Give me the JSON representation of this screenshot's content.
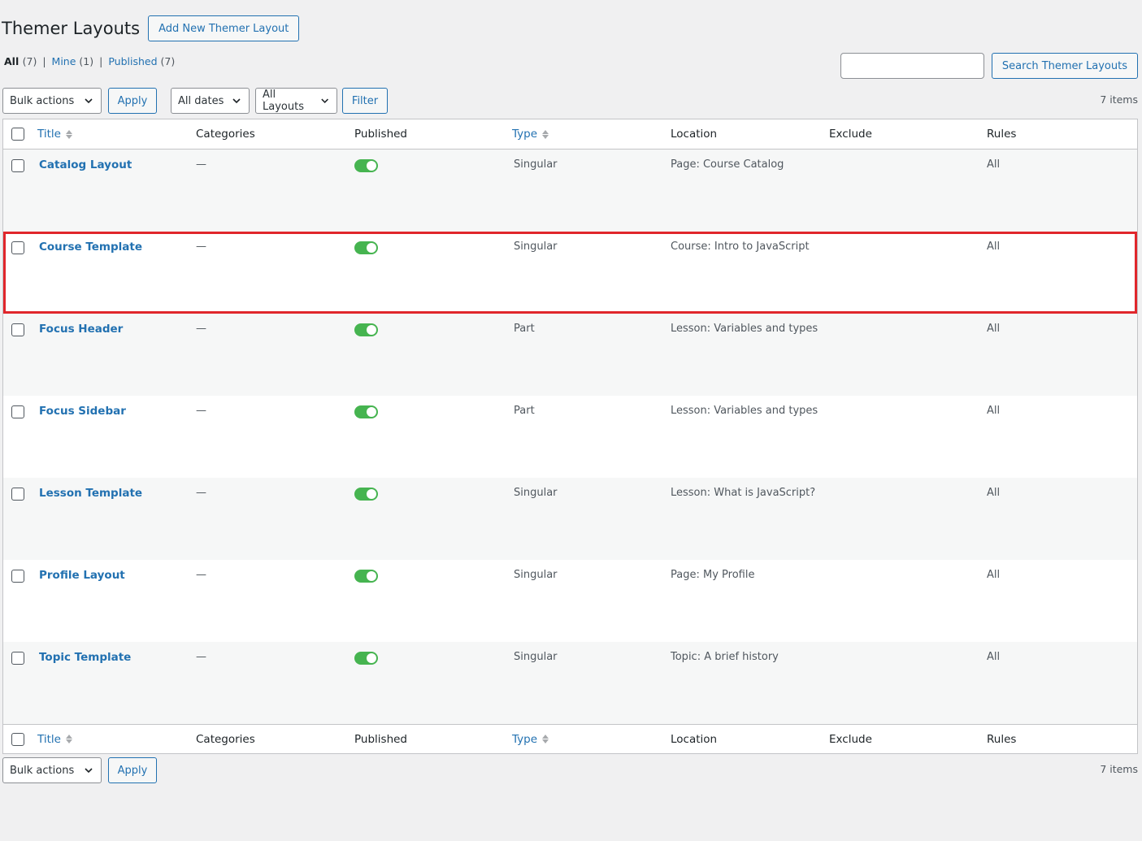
{
  "header": {
    "title": "Themer Layouts",
    "add_new_label": "Add New Themer Layout"
  },
  "views": [
    {
      "label": "All",
      "count": "(7)"
    },
    {
      "label": "Mine",
      "count": "(1)"
    },
    {
      "label": "Published",
      "count": "(7)"
    }
  ],
  "search": {
    "value": "",
    "button_label": "Search Themer Layouts"
  },
  "tablenav": {
    "bulk_actions": "Bulk actions",
    "apply": "Apply",
    "dates": "All dates",
    "layouts": "All Layouts",
    "filter": "Filter",
    "items_count": "7 items"
  },
  "columns": {
    "title": "Title",
    "categories": "Categories",
    "published": "Published",
    "type": "Type",
    "location": "Location",
    "exclude": "Exclude",
    "rules": "Rules"
  },
  "rows": [
    {
      "title": "Catalog Layout",
      "categories": "—",
      "published": true,
      "type": "Singular",
      "location": "Page: Course Catalog",
      "exclude": "",
      "rules": "All"
    },
    {
      "title": "Course Template",
      "categories": "—",
      "published": true,
      "type": "Singular",
      "location": "Course: Intro to JavaScript",
      "exclude": "",
      "rules": "All"
    },
    {
      "title": "Focus Header",
      "categories": "—",
      "published": true,
      "type": "Part",
      "location": "Lesson: Variables and types",
      "exclude": "",
      "rules": "All"
    },
    {
      "title": "Focus Sidebar",
      "categories": "—",
      "published": true,
      "type": "Part",
      "location": "Lesson: Variables and types",
      "exclude": "",
      "rules": "All"
    },
    {
      "title": "Lesson Template",
      "categories": "—",
      "published": true,
      "type": "Singular",
      "location": "Lesson: What is JavaScript?",
      "exclude": "",
      "rules": "All"
    },
    {
      "title": "Profile Layout",
      "categories": "—",
      "published": true,
      "type": "Singular",
      "location": "Page: My Profile",
      "exclude": "",
      "rules": "All"
    },
    {
      "title": "Topic Template",
      "categories": "—",
      "published": true,
      "type": "Singular",
      "location": "Topic: A brief history",
      "exclude": "",
      "rules": "All"
    }
  ],
  "colors": {
    "link": "#2271b1",
    "toggle_on": "#46b450",
    "highlight": "#e0262b"
  }
}
